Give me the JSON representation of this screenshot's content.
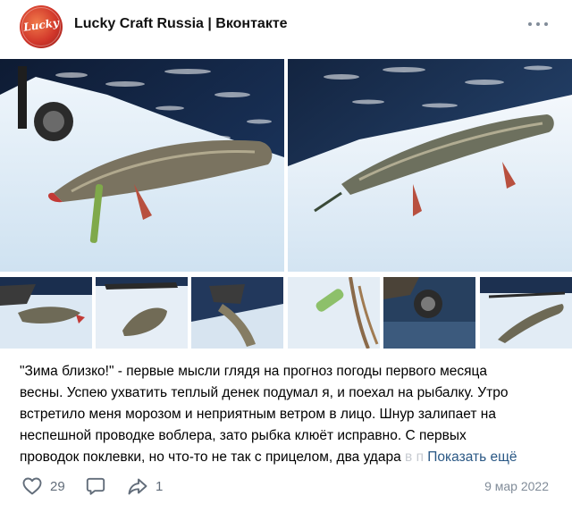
{
  "post": {
    "author": "Lucky Craft Russia | Вконтакте",
    "avatar_text": "Lucky",
    "menu_icon": "more-horizontal-icon",
    "text_lines": [
      "\"Зима близко!\" - первые мысли глядя на прогноз погоды первого месяца",
      "весны. Успею ухватить теплый денек подумал я, и поехал на рыбалку. Утро",
      "встретило меня морозом и неприятным ветром в лицо. Шнур залипает на",
      "неспешной проводке воблера, зато рыбка клюёт исправно. С первых"
    ],
    "last_line": "проводок поклевки, но что-то не так с прицелом, два удара",
    "last_line_fade": "в п",
    "show_more": "Показать ещё",
    "likes": "29",
    "shares": "1",
    "date": "9 мар 2022",
    "icons": {
      "like": "heart-icon",
      "comment": "comment-icon",
      "share": "share-icon"
    },
    "colors": {
      "accent": "#2a5885",
      "muted": "#818c99",
      "icon": "#626d7a"
    }
  }
}
